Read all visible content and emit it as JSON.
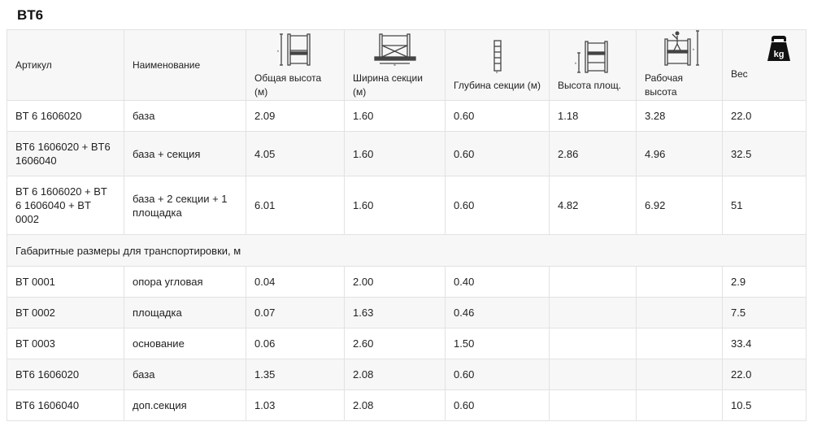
{
  "title": "BT6",
  "headers": {
    "article": "Артикул",
    "name": "Наименование",
    "total_height": "Общая высота (м)",
    "section_width": "Ширина секции (м)",
    "section_depth": "Глубина секции (м)",
    "platform_height": "Высота площ.",
    "working_height": "Рабочая высота",
    "weight": "Вес"
  },
  "weight_icon_label": "kg",
  "rows": [
    {
      "article": "BT 6 1606020",
      "name": "база",
      "total_height": "2.09",
      "width": "1.60",
      "depth": "0.60",
      "platform": "1.18",
      "working": "3.28",
      "weight": "22.0"
    },
    {
      "article": "BT6 1606020 + BT6 1606040",
      "name": "база + секция",
      "total_height": "4.05",
      "width": "1.60",
      "depth": "0.60",
      "platform": "2.86",
      "working": "4.96",
      "weight": "32.5"
    },
    {
      "article": "BT 6 1606020 + BT 6 1606040 + BT 0002",
      "name": "база + 2 секции + 1 площадка",
      "total_height": "6.01",
      "width": "1.60",
      "depth": "0.60",
      "platform": "4.82",
      "working": "6.92",
      "weight": "51"
    }
  ],
  "transport_caption": "Габаритные размеры для транспортировки, м",
  "transport_rows": [
    {
      "article": "BT 0001",
      "name": "опора угловая",
      "total_height": "0.04",
      "width": "2.00",
      "depth": "0.40",
      "platform": "",
      "working": "",
      "weight": "2.9"
    },
    {
      "article": "BT 0002",
      "name": "площадка",
      "total_height": "0.07",
      "width": "1.63",
      "depth": "0.46",
      "platform": "",
      "working": "",
      "weight": "7.5"
    },
    {
      "article": "BT 0003",
      "name": "основание",
      "total_height": "0.06",
      "width": "2.60",
      "depth": "1.50",
      "platform": "",
      "working": "",
      "weight": "33.4"
    },
    {
      "article": "BT6 1606020",
      "name": "база",
      "total_height": "1.35",
      "width": "2.08",
      "depth": "0.60",
      "platform": "",
      "working": "",
      "weight": "22.0"
    },
    {
      "article": "BT6 1606040",
      "name": "доп.секция",
      "total_height": "1.03",
      "width": "2.08",
      "depth": "0.60",
      "platform": "",
      "working": "",
      "weight": "10.5"
    }
  ]
}
